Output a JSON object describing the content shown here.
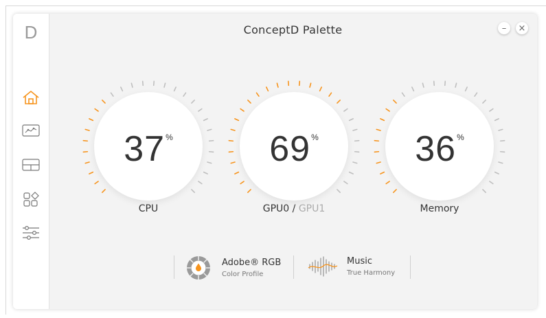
{
  "app": {
    "logo_letter": "D",
    "title": "ConceptD Palette"
  },
  "window_controls": {
    "minimize": "–",
    "close": "×"
  },
  "sidebar": {
    "items": [
      {
        "icon": "home-icon",
        "active": true
      },
      {
        "icon": "monitor-chart-icon",
        "active": false
      },
      {
        "icon": "layout-icon",
        "active": false
      },
      {
        "icon": "apps-icon",
        "active": false
      },
      {
        "icon": "sliders-icon",
        "active": false
      }
    ]
  },
  "gauges": [
    {
      "value": "37",
      "unit": "%",
      "label": "CPU",
      "label_secondary": "",
      "fraction": 0.37
    },
    {
      "value": "69",
      "unit": "%",
      "label": "GPU0",
      "separator": " / ",
      "label_secondary": "GPU1",
      "fraction": 0.69
    },
    {
      "value": "36",
      "unit": "%",
      "label": "Memory",
      "label_secondary": "",
      "fraction": 0.36
    }
  ],
  "profile": {
    "title": "Adobe® RGB",
    "subtitle": "Color Profile",
    "icon": "color-profile-icon"
  },
  "audio": {
    "title": "Music",
    "subtitle": "True Harmony",
    "icon": "sound-wave-icon"
  },
  "colors": {
    "accent": "#f7941d",
    "tick_inactive": "#bfbfbf"
  }
}
